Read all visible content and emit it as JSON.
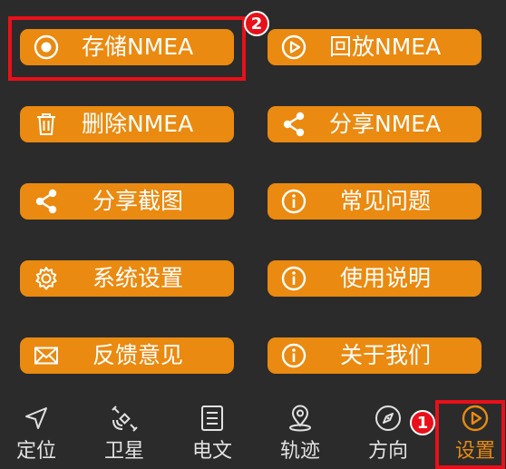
{
  "buttons": {
    "store_nmea": "存储NMEA",
    "replay_nmea": "回放NMEA",
    "delete_nmea": "删除NMEA",
    "share_nmea": "分享NMEA",
    "share_screenshot": "分享截图",
    "faq": "常见问题",
    "system_settings": "系统设置",
    "instructions": "使用说明",
    "feedback": "反馈意见",
    "about_us": "关于我们"
  },
  "nav": {
    "locate": "定位",
    "satellite": "卫星",
    "message": "电文",
    "track": "轨迹",
    "direction": "方向",
    "settings": "设置"
  },
  "badges": {
    "first": "1",
    "second": "2"
  },
  "colors": {
    "accent": "#ea8a10",
    "highlight": "#e8101a",
    "background": "#2b2b2b"
  }
}
